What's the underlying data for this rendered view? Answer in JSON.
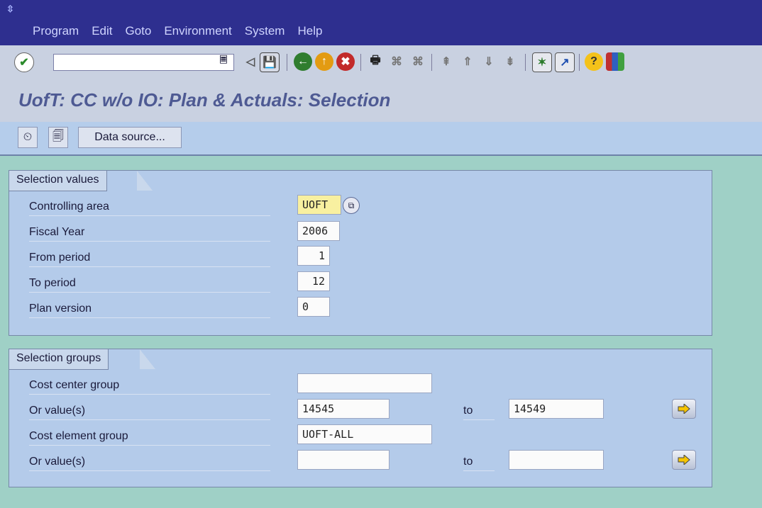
{
  "menu": {
    "items": [
      "Program",
      "Edit",
      "Goto",
      "Environment",
      "System",
      "Help"
    ]
  },
  "toolbar": {
    "command_field_value": ""
  },
  "title": "UofT: CC w/o IO: Plan & Actuals: Selection",
  "app_toolbar": {
    "data_source_label": "Data source..."
  },
  "selection_values": {
    "title": "Selection values",
    "controlling_area": {
      "label": "Controlling area",
      "value": "UOFT"
    },
    "fiscal_year": {
      "label": "Fiscal Year",
      "value": "2006"
    },
    "from_period": {
      "label": "From period",
      "value": "1"
    },
    "to_period": {
      "label": "To period",
      "value": "12"
    },
    "plan_version": {
      "label": "Plan version",
      "value": "0"
    }
  },
  "selection_groups": {
    "title": "Selection groups",
    "cost_center_group": {
      "label": "Cost center group",
      "value": ""
    },
    "cc_values": {
      "label": "Or value(s)",
      "from": "14545",
      "to_label": "to",
      "to": "14549"
    },
    "cost_element_group": {
      "label": "Cost element group",
      "value": "UOFT-ALL"
    },
    "ce_values": {
      "label": "Or value(s)",
      "from": "",
      "to_label": "to",
      "to": ""
    }
  },
  "colors": {
    "menubar": "#2e2f8f",
    "toolbar": "#c9d1e1",
    "app_toolbar": "#b5cdeb",
    "groupbox": "#b4cbea",
    "background": "#9fd0c6",
    "title_text": "#4e5a93"
  }
}
